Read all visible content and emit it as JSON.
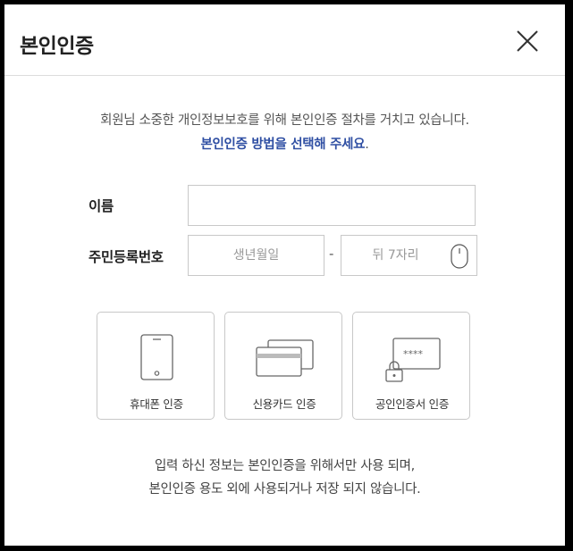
{
  "header": {
    "title": "본인인증",
    "close_icon": "close-icon"
  },
  "intro": {
    "line1": "회원님 소중한 개인정보보호를 위해 본인인증 절차를 거치고 있습니다.",
    "line2_highlight": "본인인증 방법을 선택해 주세요",
    "line2_suffix": "."
  },
  "form": {
    "name_label": "이름",
    "name_value": "",
    "rrn_label": "주민등록번호",
    "birth_placeholder": "생년월일",
    "dash": "-",
    "back_placeholder": "뒤 7자리",
    "keypad_icon": "mouse-icon"
  },
  "methods": [
    {
      "label": "휴대폰 인증",
      "icon": "mobile-phone-icon"
    },
    {
      "label": "신용카드 인증",
      "icon": "credit-card-icon"
    },
    {
      "label": "공인인증서 인증",
      "icon": "certificate-icon"
    }
  ],
  "footer": {
    "line1": "입력 하신 정보는 본인인증을 위해서만 사용 되며,",
    "line2": "본인인증 용도 외에 사용되거나 저장 되지 않습니다."
  },
  "colors": {
    "highlight": "#2f4fa3",
    "border": "#c8c8c8",
    "frame": "#000000"
  }
}
